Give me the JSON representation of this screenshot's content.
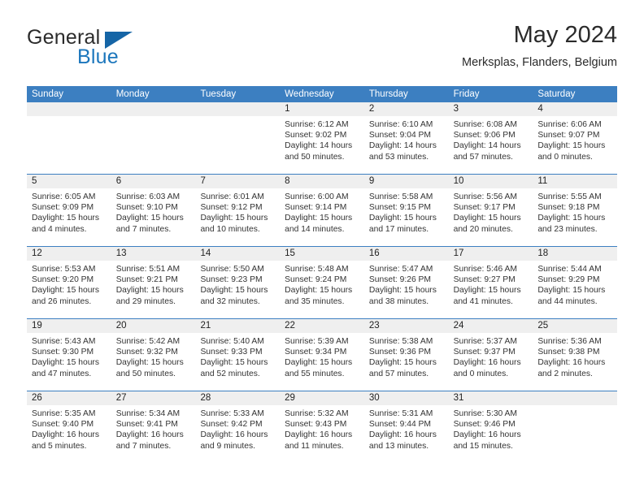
{
  "brand": {
    "word_one": "General",
    "word_two": "Blue",
    "logo_icon": "triangle-logo-icon"
  },
  "header": {
    "title": "May 2024",
    "location": "Merksplas, Flanders, Belgium"
  },
  "colors": {
    "header_blue": "#3c7fc1",
    "brand_blue": "#1b76bc",
    "daynum_band": "#efefef",
    "text": "#222222"
  },
  "weekday_headers": [
    "Sunday",
    "Monday",
    "Tuesday",
    "Wednesday",
    "Thursday",
    "Friday",
    "Saturday"
  ],
  "weeks": [
    [
      {
        "day": "",
        "empty": true
      },
      {
        "day": "",
        "empty": true
      },
      {
        "day": "",
        "empty": true
      },
      {
        "day": "1",
        "sunrise": "Sunrise: 6:12 AM",
        "sunset": "Sunset: 9:02 PM",
        "daylight_line1": "Daylight: 14 hours",
        "daylight_line2": "and 50 minutes."
      },
      {
        "day": "2",
        "sunrise": "Sunrise: 6:10 AM",
        "sunset": "Sunset: 9:04 PM",
        "daylight_line1": "Daylight: 14 hours",
        "daylight_line2": "and 53 minutes."
      },
      {
        "day": "3",
        "sunrise": "Sunrise: 6:08 AM",
        "sunset": "Sunset: 9:06 PM",
        "daylight_line1": "Daylight: 14 hours",
        "daylight_line2": "and 57 minutes."
      },
      {
        "day": "4",
        "sunrise": "Sunrise: 6:06 AM",
        "sunset": "Sunset: 9:07 PM",
        "daylight_line1": "Daylight: 15 hours",
        "daylight_line2": "and 0 minutes."
      }
    ],
    [
      {
        "day": "5",
        "sunrise": "Sunrise: 6:05 AM",
        "sunset": "Sunset: 9:09 PM",
        "daylight_line1": "Daylight: 15 hours",
        "daylight_line2": "and 4 minutes."
      },
      {
        "day": "6",
        "sunrise": "Sunrise: 6:03 AM",
        "sunset": "Sunset: 9:10 PM",
        "daylight_line1": "Daylight: 15 hours",
        "daylight_line2": "and 7 minutes."
      },
      {
        "day": "7",
        "sunrise": "Sunrise: 6:01 AM",
        "sunset": "Sunset: 9:12 PM",
        "daylight_line1": "Daylight: 15 hours",
        "daylight_line2": "and 10 minutes."
      },
      {
        "day": "8",
        "sunrise": "Sunrise: 6:00 AM",
        "sunset": "Sunset: 9:14 PM",
        "daylight_line1": "Daylight: 15 hours",
        "daylight_line2": "and 14 minutes."
      },
      {
        "day": "9",
        "sunrise": "Sunrise: 5:58 AM",
        "sunset": "Sunset: 9:15 PM",
        "daylight_line1": "Daylight: 15 hours",
        "daylight_line2": "and 17 minutes."
      },
      {
        "day": "10",
        "sunrise": "Sunrise: 5:56 AM",
        "sunset": "Sunset: 9:17 PM",
        "daylight_line1": "Daylight: 15 hours",
        "daylight_line2": "and 20 minutes."
      },
      {
        "day": "11",
        "sunrise": "Sunrise: 5:55 AM",
        "sunset": "Sunset: 9:18 PM",
        "daylight_line1": "Daylight: 15 hours",
        "daylight_line2": "and 23 minutes."
      }
    ],
    [
      {
        "day": "12",
        "sunrise": "Sunrise: 5:53 AM",
        "sunset": "Sunset: 9:20 PM",
        "daylight_line1": "Daylight: 15 hours",
        "daylight_line2": "and 26 minutes."
      },
      {
        "day": "13",
        "sunrise": "Sunrise: 5:51 AM",
        "sunset": "Sunset: 9:21 PM",
        "daylight_line1": "Daylight: 15 hours",
        "daylight_line2": "and 29 minutes."
      },
      {
        "day": "14",
        "sunrise": "Sunrise: 5:50 AM",
        "sunset": "Sunset: 9:23 PM",
        "daylight_line1": "Daylight: 15 hours",
        "daylight_line2": "and 32 minutes."
      },
      {
        "day": "15",
        "sunrise": "Sunrise: 5:48 AM",
        "sunset": "Sunset: 9:24 PM",
        "daylight_line1": "Daylight: 15 hours",
        "daylight_line2": "and 35 minutes."
      },
      {
        "day": "16",
        "sunrise": "Sunrise: 5:47 AM",
        "sunset": "Sunset: 9:26 PM",
        "daylight_line1": "Daylight: 15 hours",
        "daylight_line2": "and 38 minutes."
      },
      {
        "day": "17",
        "sunrise": "Sunrise: 5:46 AM",
        "sunset": "Sunset: 9:27 PM",
        "daylight_line1": "Daylight: 15 hours",
        "daylight_line2": "and 41 minutes."
      },
      {
        "day": "18",
        "sunrise": "Sunrise: 5:44 AM",
        "sunset": "Sunset: 9:29 PM",
        "daylight_line1": "Daylight: 15 hours",
        "daylight_line2": "and 44 minutes."
      }
    ],
    [
      {
        "day": "19",
        "sunrise": "Sunrise: 5:43 AM",
        "sunset": "Sunset: 9:30 PM",
        "daylight_line1": "Daylight: 15 hours",
        "daylight_line2": "and 47 minutes."
      },
      {
        "day": "20",
        "sunrise": "Sunrise: 5:42 AM",
        "sunset": "Sunset: 9:32 PM",
        "daylight_line1": "Daylight: 15 hours",
        "daylight_line2": "and 50 minutes."
      },
      {
        "day": "21",
        "sunrise": "Sunrise: 5:40 AM",
        "sunset": "Sunset: 9:33 PM",
        "daylight_line1": "Daylight: 15 hours",
        "daylight_line2": "and 52 minutes."
      },
      {
        "day": "22",
        "sunrise": "Sunrise: 5:39 AM",
        "sunset": "Sunset: 9:34 PM",
        "daylight_line1": "Daylight: 15 hours",
        "daylight_line2": "and 55 minutes."
      },
      {
        "day": "23",
        "sunrise": "Sunrise: 5:38 AM",
        "sunset": "Sunset: 9:36 PM",
        "daylight_line1": "Daylight: 15 hours",
        "daylight_line2": "and 57 minutes."
      },
      {
        "day": "24",
        "sunrise": "Sunrise: 5:37 AM",
        "sunset": "Sunset: 9:37 PM",
        "daylight_line1": "Daylight: 16 hours",
        "daylight_line2": "and 0 minutes."
      },
      {
        "day": "25",
        "sunrise": "Sunrise: 5:36 AM",
        "sunset": "Sunset: 9:38 PM",
        "daylight_line1": "Daylight: 16 hours",
        "daylight_line2": "and 2 minutes."
      }
    ],
    [
      {
        "day": "26",
        "sunrise": "Sunrise: 5:35 AM",
        "sunset": "Sunset: 9:40 PM",
        "daylight_line1": "Daylight: 16 hours",
        "daylight_line2": "and 5 minutes."
      },
      {
        "day": "27",
        "sunrise": "Sunrise: 5:34 AM",
        "sunset": "Sunset: 9:41 PM",
        "daylight_line1": "Daylight: 16 hours",
        "daylight_line2": "and 7 minutes."
      },
      {
        "day": "28",
        "sunrise": "Sunrise: 5:33 AM",
        "sunset": "Sunset: 9:42 PM",
        "daylight_line1": "Daylight: 16 hours",
        "daylight_line2": "and 9 minutes."
      },
      {
        "day": "29",
        "sunrise": "Sunrise: 5:32 AM",
        "sunset": "Sunset: 9:43 PM",
        "daylight_line1": "Daylight: 16 hours",
        "daylight_line2": "and 11 minutes."
      },
      {
        "day": "30",
        "sunrise": "Sunrise: 5:31 AM",
        "sunset": "Sunset: 9:44 PM",
        "daylight_line1": "Daylight: 16 hours",
        "daylight_line2": "and 13 minutes."
      },
      {
        "day": "31",
        "sunrise": "Sunrise: 5:30 AM",
        "sunset": "Sunset: 9:46 PM",
        "daylight_line1": "Daylight: 16 hours",
        "daylight_line2": "and 15 minutes."
      },
      {
        "day": "",
        "empty": true
      }
    ]
  ]
}
